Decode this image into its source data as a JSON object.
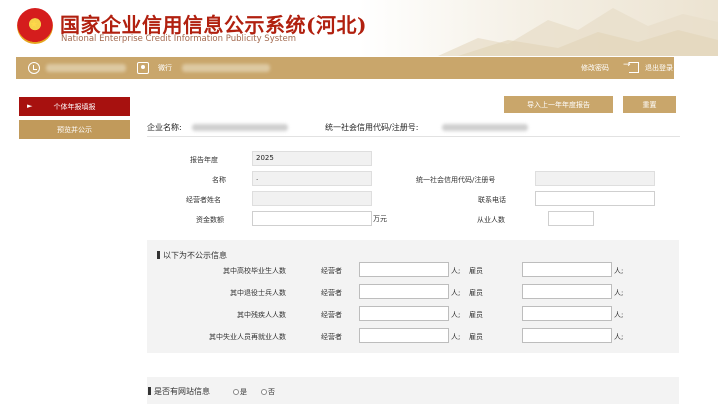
{
  "header": {
    "title": "国家企业信用信息公示系统(河北)",
    "subtitle": "National Enterprise Credit Information Publicity System",
    "emblem_star": "★"
  },
  "userbar": {
    "user_label": "微行",
    "change_password": "修改密码",
    "logout": "退出登录"
  },
  "sidebar": {
    "items": [
      {
        "label": "个体年报填报",
        "active": true
      },
      {
        "label": "预览并公示",
        "active": false
      }
    ],
    "arrow": "►"
  },
  "actions": {
    "import_label": "导入上一年年度报告",
    "reset_label": "重置"
  },
  "company": {
    "name_label": "企业名称:",
    "credit_code_label": "统一社会信用代码/注册号:"
  },
  "form": {
    "report_year_label": "报告年度",
    "report_year_value": "2025",
    "name_label": "名称",
    "name_value": ".",
    "credit_code_label": "统一社会信用代码/注册号",
    "operator_label": "经营者姓名",
    "phone_label": "联系电话",
    "capital_label": "资金数额",
    "capital_unit": "万元",
    "employees_label": "从业人数"
  },
  "nonpublic": {
    "title": "以下为不公示信息",
    "operator_label": "经营者",
    "employee_label": "雇员",
    "suffix_person": "人;",
    "rows": [
      {
        "label": "其中高校毕业生人数"
      },
      {
        "label": "其中退役士兵人数"
      },
      {
        "label": "其中残疾人人数"
      },
      {
        "label": "其中失业人员再就业人数"
      }
    ]
  },
  "website": {
    "title": "是否有网站信息",
    "yes": "是",
    "no": "否"
  },
  "colors": {
    "title_red": "#b1200f",
    "gold": "#c9a66b",
    "active_red": "#a7110f"
  }
}
